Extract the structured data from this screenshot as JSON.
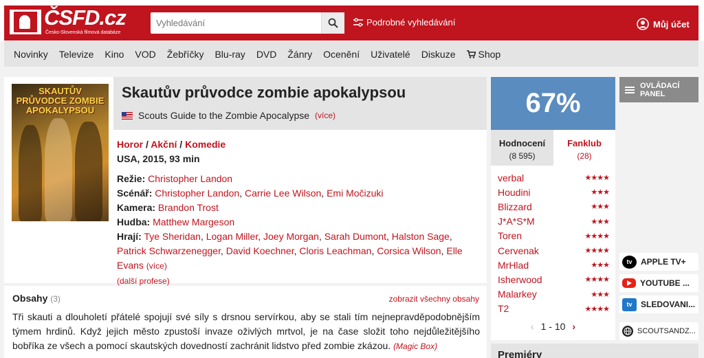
{
  "header": {
    "logo_text": "ČSFD.cz",
    "logo_tagline": "Česko-Slovenská filmová databáze",
    "search_placeholder": "Vyhledávání",
    "advanced_search_label": "Podrobné vyhledávání",
    "account_label": "Můj účet"
  },
  "nav": {
    "items": [
      "Novinky",
      "Televize",
      "Kino",
      "VOD",
      "Žebříčky",
      "Blu-ray",
      "DVD",
      "Žánry",
      "Ocenění",
      "Uživatelé",
      "Diskuze",
      "Shop"
    ]
  },
  "film": {
    "poster_text": "SKAUTŮV PRŮVODCE ZOMBIE APOKALYPSOU",
    "title": "Skautův průvodce zombie apokalypsou",
    "original_title": "Scouts Guide to the Zombie Apocalypse",
    "more_label": "(více)",
    "genres": [
      "Horor",
      "Akční",
      "Komedie"
    ],
    "genre_sep": " / ",
    "meta": "USA, 2015, 93 min",
    "directing_label": "Režie:",
    "directing": "Christopher Landon",
    "screenplay_label": "Scénář:",
    "screenplay": [
      "Christopher Landon",
      "Carrie Lee Wilson",
      "Emi Močizuki"
    ],
    "camera_label": "Kamera:",
    "camera": "Brandon Trost",
    "music_label": "Hudba:",
    "music": "Matthew Margeson",
    "cast_label": "Hrají:",
    "cast": [
      "Tye Sheridan",
      "Logan Miller",
      "Joey Morgan",
      "Sarah Dumont",
      "Halston Sage",
      "Patrick Schwarzenegger",
      "David Koechner",
      "Cloris Leachman",
      "Corsica Wilson",
      "Elle Evans"
    ],
    "cast_more_label": "(více)",
    "more_professions_label": "(další profese)"
  },
  "plot": {
    "heading": "Obsahy",
    "count": "(3)",
    "show_all_label": "zobrazit všechny obsahy",
    "text": "Tři skauti a dlouholetí přátelé spojují své síly s drsnou servírkou, aby se stali tím nejnepravděpodobnějším týmem hrdinů. Když jejich město zpustoší invaze oživlých mrtvol, je na čase složit toho nejdůležitějšího bobříka ze všech a pomocí skautských dovedností zachránit lidstvo před zombie zkázou.",
    "source": "(Magic Box)"
  },
  "rating": {
    "percent": "67%",
    "tab_ratings_label": "Hodnocení",
    "tab_ratings_count": "(8 595)",
    "tab_fanclub_label": "Fanklub",
    "tab_fanclub_count": "(28)",
    "reviews": [
      {
        "user": "verbal",
        "stars": 4,
        "stars_text": "★★★★"
      },
      {
        "user": "Houdini",
        "stars": 3,
        "stars_text": "★★★"
      },
      {
        "user": "Blizzard",
        "stars": 3,
        "stars_text": "★★★"
      },
      {
        "user": "J*A*S*M",
        "stars": 3,
        "stars_text": "★★★"
      },
      {
        "user": "Toren",
        "stars": 4,
        "stars_text": "★★★★"
      },
      {
        "user": "Cervenak",
        "stars": 4,
        "stars_text": "★★★★"
      },
      {
        "user": "MrHlad",
        "stars": 3,
        "stars_text": "★★★"
      },
      {
        "user": "Isherwood",
        "stars": 4,
        "stars_text": "★★★★"
      },
      {
        "user": "Malarkey",
        "stars": 3,
        "stars_text": "★★★"
      },
      {
        "user": "T2",
        "stars": 4,
        "stars_text": "★★★★"
      }
    ],
    "pager_label": "1 - 10",
    "prev_glyph": "‹",
    "next_glyph": "›"
  },
  "sidebar": {
    "control_panel_label": "OVLÁDACÍ PANEL",
    "vod": [
      {
        "label": "APPLE TV+",
        "icon": "apple-tv-icon",
        "color": "#000000"
      },
      {
        "label": "YOUTUBE ...",
        "icon": "youtube-icon",
        "color": "#e62117"
      },
      {
        "label": "SLEDOVANI...",
        "icon": "sledovani-tv-icon",
        "color": "#1f78c8"
      },
      {
        "label": "SCOUTSANDZ...",
        "icon": "globe-icon",
        "color": "#222222"
      }
    ]
  },
  "premiery_label": "Premiéry",
  "colors": {
    "brand_red": "#c0141e",
    "rating_blue": "#5b8cbf"
  }
}
